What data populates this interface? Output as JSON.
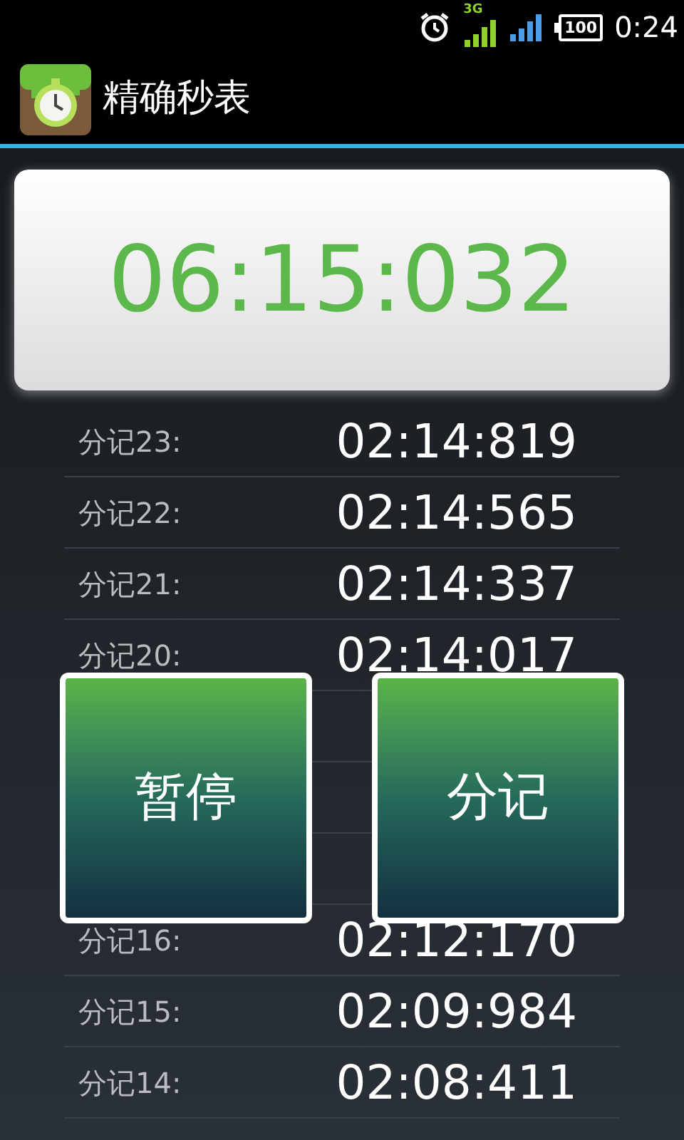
{
  "status_bar": {
    "network": "3G",
    "battery": "100",
    "time": "0:24"
  },
  "app_bar": {
    "title": "精确秒表"
  },
  "timer": {
    "display": "06:15:032"
  },
  "laps_above": [
    {
      "label": "分记23:",
      "time": "02:14:819"
    },
    {
      "label": "分记22:",
      "time": "02:14:565"
    },
    {
      "label": "分记21:",
      "time": "02:14:337"
    },
    {
      "label": "分记20:",
      "time": "02:14:017"
    }
  ],
  "laps_below": [
    {
      "label": "分记16:",
      "time": "02:12:170"
    },
    {
      "label": "分记15:",
      "time": "02:09:984"
    },
    {
      "label": "分记14:",
      "time": "02:08:411"
    }
  ],
  "buttons": [
    {
      "label": "暂停"
    },
    {
      "label": "分记"
    }
  ]
}
